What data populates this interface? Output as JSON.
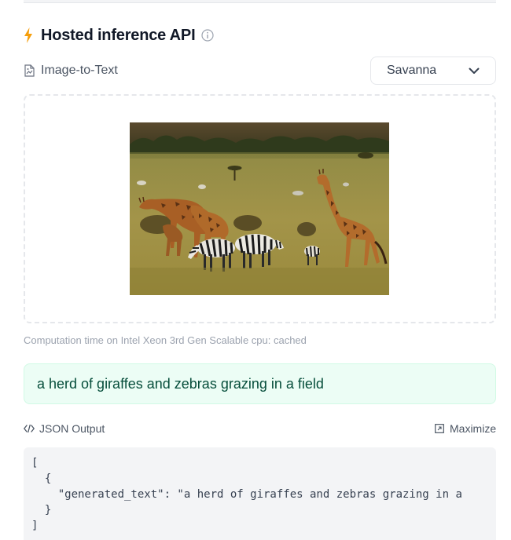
{
  "header": {
    "title": "Hosted inference API",
    "bolt_icon": "lightning-bolt-icon",
    "info_icon": "info-circle-icon",
    "accent_color": "#f59e0b"
  },
  "task": {
    "label": "Image-to-Text",
    "icon": "image-to-text-icon"
  },
  "example_select": {
    "value": "Savanna",
    "icon": "chevron-down-icon"
  },
  "input": {
    "image_subject": "giraffes and zebras in savanna"
  },
  "computation": {
    "text": "Computation time on Intel Xeon 3rd Gen Scalable cpu: cached"
  },
  "output": {
    "text": "a herd of giraffes and zebras grazing in a field",
    "color": "#064e3b",
    "background": "#ecfdf5"
  },
  "json_output": {
    "label": "JSON Output",
    "icon": "code-icon",
    "maximize_label": "Maximize",
    "maximize_icon": "maximize-icon",
    "lines": [
      "[",
      "  {",
      "    \"generated_text\": \"a herd of giraffes and zebras grazing in a",
      "  }",
      "]"
    ]
  }
}
